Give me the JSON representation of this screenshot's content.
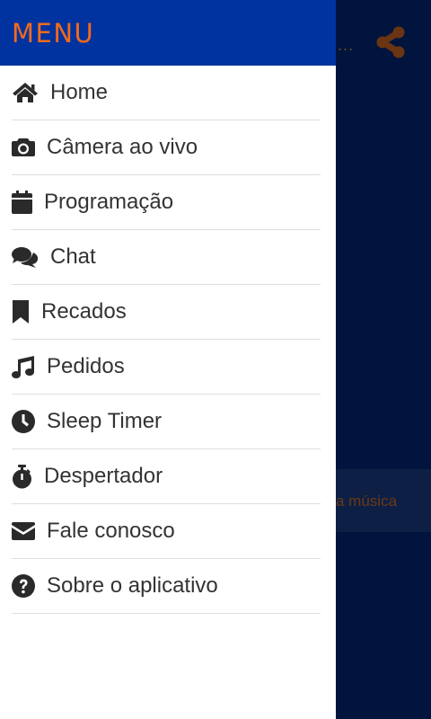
{
  "background": {
    "ellipsis": "...",
    "strip_text": "a música"
  },
  "drawer": {
    "title": "MENU",
    "items": [
      {
        "label": "Home",
        "icon": "home-icon"
      },
      {
        "label": "Câmera ao vivo",
        "icon": "camera-icon"
      },
      {
        "label": "Programação",
        "icon": "calendar-icon"
      },
      {
        "label": "Chat",
        "icon": "comments-icon"
      },
      {
        "label": "Recados",
        "icon": "bookmark-icon"
      },
      {
        "label": "Pedidos",
        "icon": "music-icon"
      },
      {
        "label": "Sleep Timer",
        "icon": "clock-icon"
      },
      {
        "label": "Despertador",
        "icon": "stopwatch-icon"
      },
      {
        "label": "Fale conosco",
        "icon": "envelope-icon"
      },
      {
        "label": "Sobre o aplicativo",
        "icon": "question-circle-icon"
      }
    ]
  },
  "colors": {
    "header_bg": "#0033a0",
    "accent": "#f26a1b",
    "overlay_bg": "#00143d"
  }
}
